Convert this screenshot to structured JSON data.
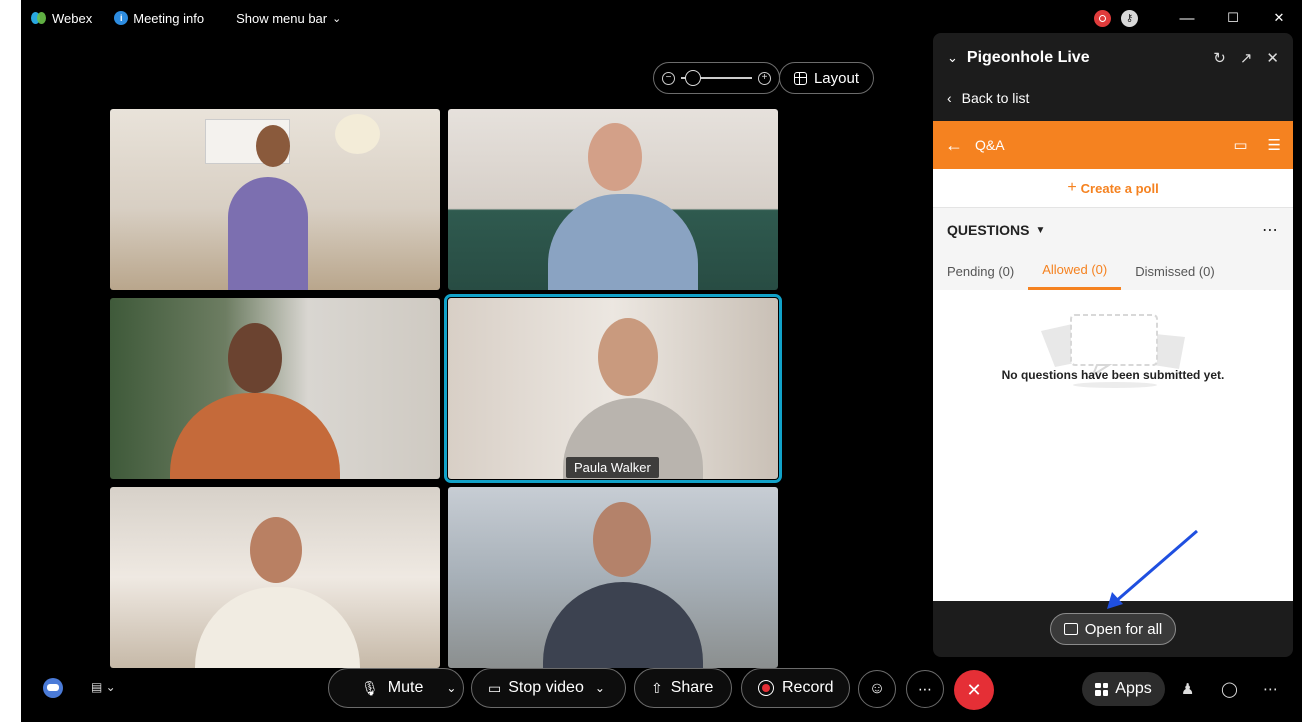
{
  "topbar": {
    "app_name": "Webex",
    "meeting_info": "Meeting info",
    "show_menu_bar": "Show menu bar",
    "window_controls": [
      "—",
      "☐",
      "✕"
    ]
  },
  "view_controls": {
    "layout_label": "Layout"
  },
  "participants": [
    {
      "tile": "top-left"
    },
    {
      "tile": "top-right"
    },
    {
      "tile": "middle-left"
    },
    {
      "tile": "middle-right",
      "name": "Paula Walker",
      "active": true
    },
    {
      "tile": "bottom-left"
    },
    {
      "tile": "bottom-right"
    }
  ],
  "panel": {
    "title": "Pigeonhole Live",
    "back_to_list": "Back to list",
    "section": "Q&A",
    "create_poll": "Create a poll",
    "questions_label": "QUESTIONS",
    "tabs": [
      {
        "label": "Pending (0)",
        "active": false
      },
      {
        "label": "Allowed (0)",
        "active": true
      },
      {
        "label": "Dismissed (0)",
        "active": false
      }
    ],
    "empty_message": "No questions have been submitted yet.",
    "open_for_all": "Open for all"
  },
  "bottombar": {
    "mute": "Mute",
    "stop_video": "Stop video",
    "share": "Share",
    "record": "Record",
    "apps": "Apps",
    "end_color": "#e52f36"
  },
  "colors": {
    "accent": "#f58220",
    "active_tile": "#11a2c9"
  }
}
